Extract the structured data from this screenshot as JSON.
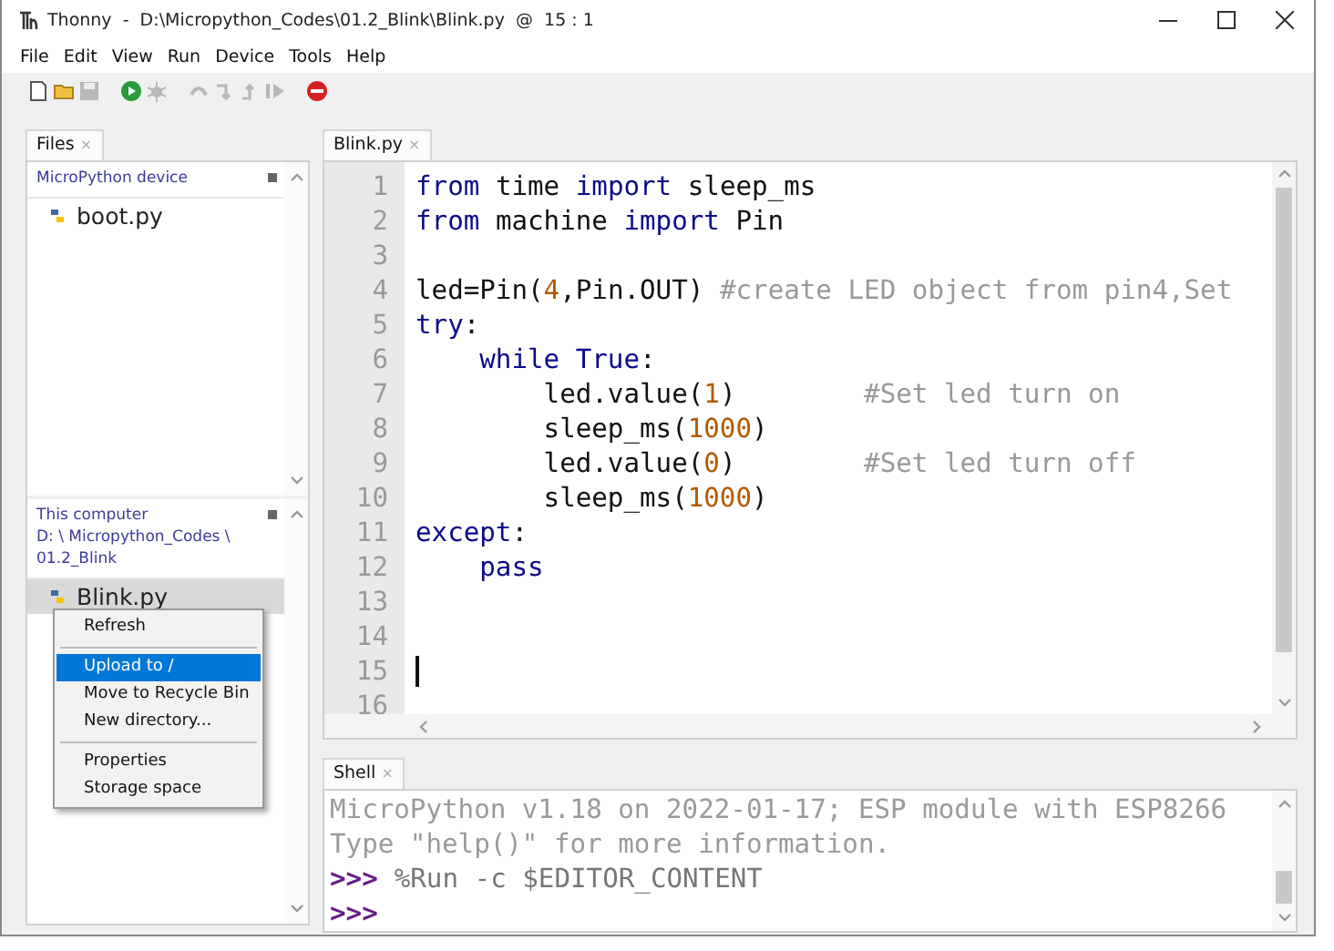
{
  "window": {
    "title": "Thonny  -  D:\\Micropython_Codes\\01.2_Blink\\Blink.py  @  15 : 1"
  },
  "menu": [
    "File",
    "Edit",
    "View",
    "Run",
    "Device",
    "Tools",
    "Help"
  ],
  "toolbar": [
    {
      "kind": "new",
      "disabled": false
    },
    {
      "kind": "open",
      "disabled": false
    },
    {
      "kind": "save",
      "disabled": true
    },
    {
      "kind": "run",
      "disabled": false
    },
    {
      "kind": "debug",
      "disabled": true
    },
    {
      "kind": "step_over",
      "disabled": true
    },
    {
      "kind": "step_into",
      "disabled": true
    },
    {
      "kind": "step_out",
      "disabled": true
    },
    {
      "kind": "resume",
      "disabled": true
    },
    {
      "kind": "stop",
      "disabled": false
    }
  ],
  "files_panel": {
    "tab": {
      "label": "Files",
      "close": "×"
    },
    "device": {
      "title": "MicroPython device",
      "files": [
        {
          "name": "boot.py",
          "selected": false
        }
      ]
    },
    "computer": {
      "title": "This computer",
      "path_lines": [
        "D: \\ Micropython_Codes \\",
        "01.2_Blink"
      ],
      "files": [
        {
          "name": "Blink.py",
          "selected": true
        }
      ]
    }
  },
  "context_menu": {
    "groups": [
      [
        {
          "label": "Refresh",
          "selected": false
        }
      ],
      [
        {
          "label": "Upload to /",
          "selected": true
        },
        {
          "label": "Move to Recycle Bin",
          "selected": false
        },
        {
          "label": "New directory...",
          "selected": false
        }
      ],
      [
        {
          "label": "Properties",
          "selected": false
        },
        {
          "label": "Storage space",
          "selected": false
        }
      ]
    ]
  },
  "editor": {
    "tab": {
      "label": "Blink.py",
      "close": "×"
    },
    "lines": [
      {
        "number": "1",
        "caret": false,
        "tokens": [
          {
            "kind": "kw",
            "text": "from"
          },
          {
            "kind": "plain",
            "text": " time "
          },
          {
            "kind": "kw",
            "text": "import"
          },
          {
            "kind": "plain",
            "text": " sleep_ms"
          }
        ]
      },
      {
        "number": "2",
        "caret": false,
        "tokens": [
          {
            "kind": "kw",
            "text": "from"
          },
          {
            "kind": "plain",
            "text": " machine "
          },
          {
            "kind": "kw",
            "text": "import"
          },
          {
            "kind": "plain",
            "text": " Pin"
          }
        ]
      },
      {
        "number": "3",
        "caret": false
      },
      {
        "number": "4",
        "caret": false,
        "tokens": [
          {
            "kind": "plain",
            "text": "led=Pin("
          },
          {
            "kind": "num",
            "text": "4"
          },
          {
            "kind": "plain",
            "text": ",Pin.OUT) "
          },
          {
            "kind": "comment",
            "text": "#create LED object from pin4,Set"
          }
        ]
      },
      {
        "number": "5",
        "caret": false,
        "tokens": [
          {
            "kind": "kw",
            "text": "try"
          },
          {
            "kind": "plain",
            "text": ":"
          }
        ],
        "children": [
          {
            "number": "6",
            "caret": false,
            "tokens": [
              {
                "kind": "kw",
                "text": "while True"
              },
              {
                "kind": "plain",
                "text": ":"
              }
            ],
            "children": [
              {
                "number": "7",
                "caret": false,
                "tokens": [
                  {
                    "kind": "plain",
                    "text": "led.value("
                  },
                  {
                    "kind": "num",
                    "text": "1"
                  },
                  {
                    "kind": "plain",
                    "text": ")        "
                  },
                  {
                    "kind": "comment",
                    "text": "#Set led turn on"
                  }
                ]
              },
              {
                "number": "8",
                "caret": false,
                "tokens": [
                  {
                    "kind": "plain",
                    "text": "sleep_ms("
                  },
                  {
                    "kind": "num",
                    "text": "1000"
                  },
                  {
                    "kind": "plain",
                    "text": ")"
                  }
                ]
              },
              {
                "number": "9",
                "caret": false,
                "tokens": [
                  {
                    "kind": "plain",
                    "text": "led.value("
                  },
                  {
                    "kind": "num",
                    "text": "0"
                  },
                  {
                    "kind": "plain",
                    "text": ")        "
                  },
                  {
                    "kind": "comment",
                    "text": "#Set led turn off"
                  }
                ]
              },
              {
                "number": "10",
                "caret": false,
                "tokens": [
                  {
                    "kind": "plain",
                    "text": "sleep_ms("
                  },
                  {
                    "kind": "num",
                    "text": "1000"
                  },
                  {
                    "kind": "plain",
                    "text": ")"
                  }
                ]
              }
            ]
          }
        ]
      },
      {
        "number": "11",
        "caret": false,
        "tokens": [
          {
            "kind": "kw",
            "text": "except"
          },
          {
            "kind": "plain",
            "text": ":"
          }
        ],
        "children": [
          {
            "number": "12",
            "caret": false,
            "tokens": [
              {
                "kind": "kw",
                "text": "pass"
              }
            ]
          }
        ]
      },
      {
        "number": "13",
        "caret": false
      },
      {
        "number": "14",
        "caret": false
      },
      {
        "number": "15",
        "caret": true
      },
      {
        "number": "16",
        "caret": false
      }
    ]
  },
  "shell": {
    "tab": {
      "label": "Shell",
      "close": "×"
    },
    "lines": [
      {
        "kind": "output",
        "text": "MicroPython v1.18 on 2022-01-17; ESP module with ESP8266"
      },
      {
        "kind": "output",
        "text": "Type \"help()\" for more information."
      },
      {
        "kind": "input",
        "prompt": ">>>",
        "text": "%Run -c $EDITOR_CONTENT"
      },
      {
        "kind": "input",
        "prompt": ">>>"
      }
    ]
  }
}
